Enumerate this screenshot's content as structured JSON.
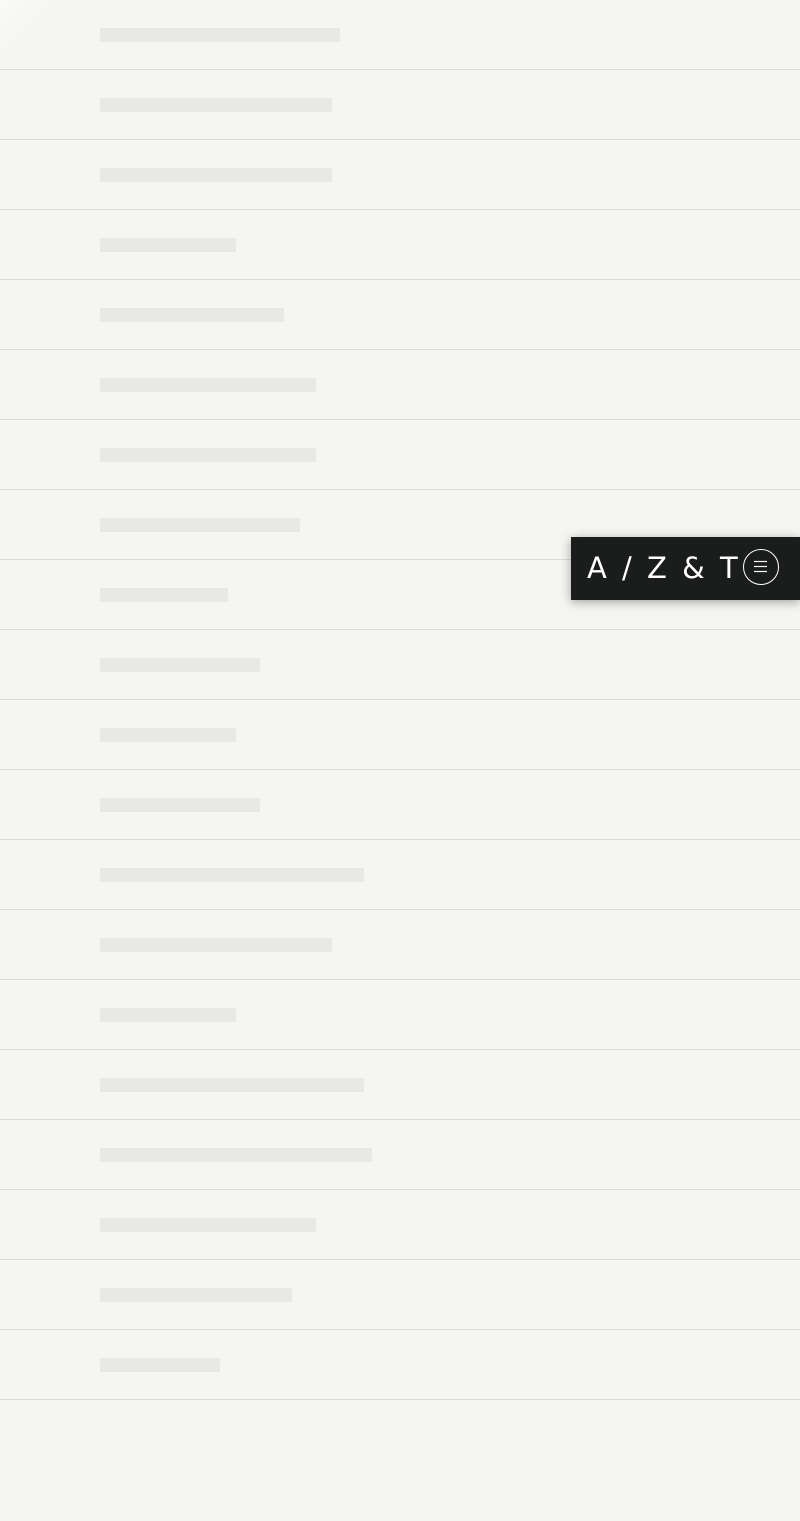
{
  "header": {
    "logo_text": "A / Z & T",
    "menu_icon": "hamburger-menu-icon"
  },
  "list": {
    "row_count": 20,
    "rows": [
      {
        "placeholder_fill": 0.3
      },
      {
        "placeholder_fill": 0.29
      },
      {
        "placeholder_fill": 0.29
      },
      {
        "placeholder_fill": 0.17
      },
      {
        "placeholder_fill": 0.23
      },
      {
        "placeholder_fill": 0.27
      },
      {
        "placeholder_fill": 0.27
      },
      {
        "placeholder_fill": 0.25
      },
      {
        "placeholder_fill": 0.16
      },
      {
        "placeholder_fill": 0.2
      },
      {
        "placeholder_fill": 0.17
      },
      {
        "placeholder_fill": 0.2
      },
      {
        "placeholder_fill": 0.33
      },
      {
        "placeholder_fill": 0.29
      },
      {
        "placeholder_fill": 0.17
      },
      {
        "placeholder_fill": 0.33
      },
      {
        "placeholder_fill": 0.34
      },
      {
        "placeholder_fill": 0.27
      },
      {
        "placeholder_fill": 0.24
      },
      {
        "placeholder_fill": 0.15
      }
    ]
  },
  "colors": {
    "background": "#f5f5f1",
    "divider": "#dcdcd6",
    "placeholder": "#e8e8e4",
    "brand_bar": "#1b1d1c",
    "brand_text": "#ffffff"
  }
}
